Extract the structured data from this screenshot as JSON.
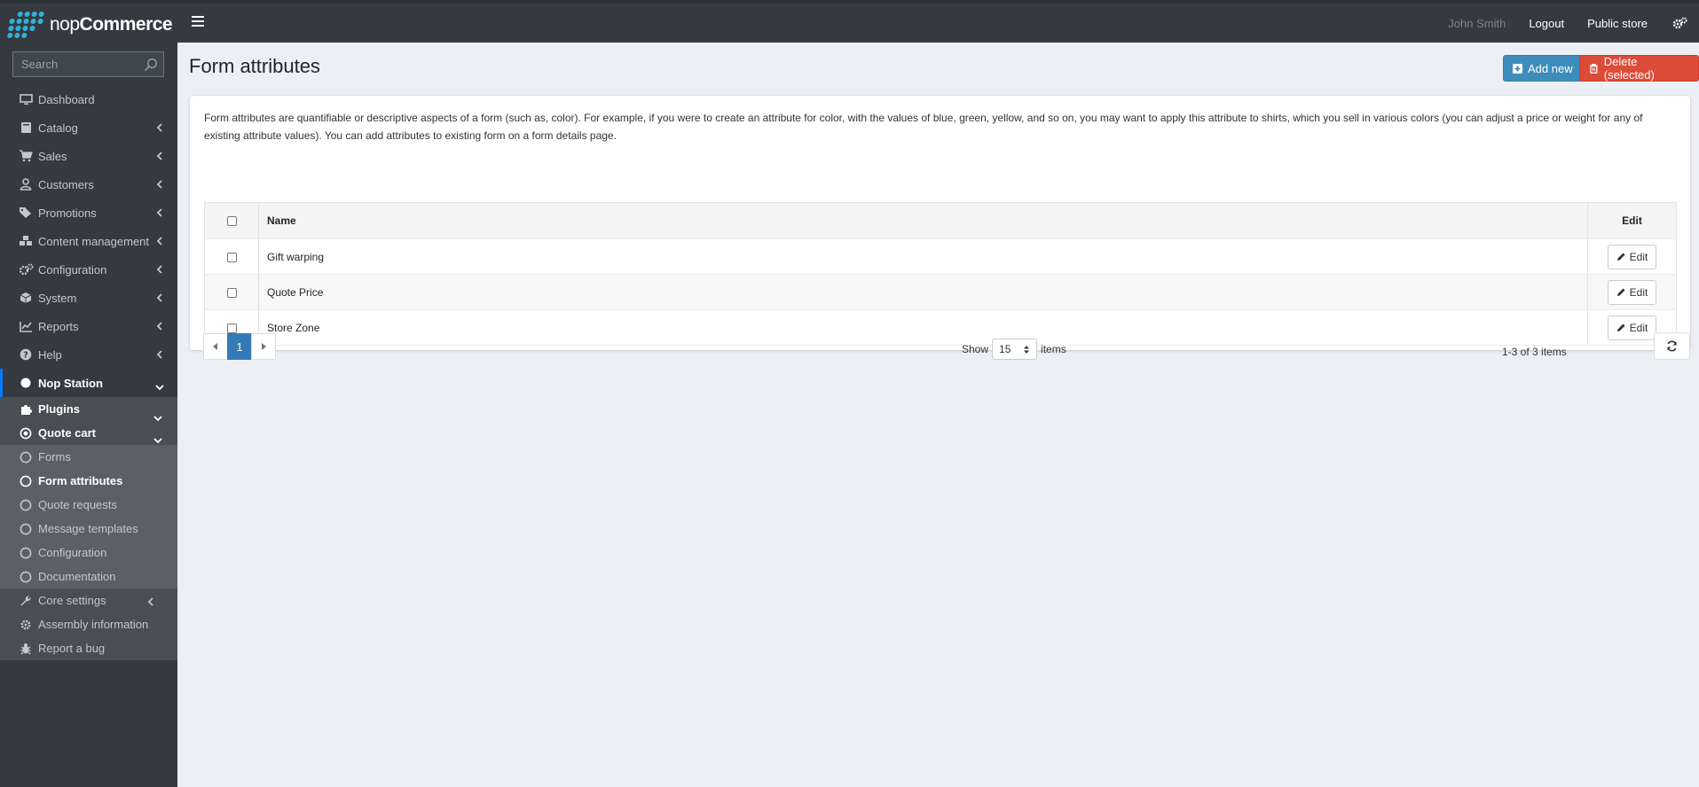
{
  "header": {
    "logo_text": "nop",
    "logo_bold": "Commerce",
    "user_name": "John Smith",
    "logout": "Logout",
    "public_store": "Public store"
  },
  "sidebar": {
    "search_placeholder": "Search",
    "items": [
      {
        "label": "Dashboard",
        "icon": "monitor-icon"
      },
      {
        "label": "Catalog",
        "icon": "book-icon"
      },
      {
        "label": "Sales",
        "icon": "cart-icon"
      },
      {
        "label": "Customers",
        "icon": "user-icon"
      },
      {
        "label": "Promotions",
        "icon": "tags-icon"
      },
      {
        "label": "Content management",
        "icon": "cubes-icon"
      },
      {
        "label": "Configuration",
        "icon": "gears-icon"
      },
      {
        "label": "System",
        "icon": "cube-icon"
      },
      {
        "label": "Reports",
        "icon": "line-chart-icon"
      },
      {
        "label": "Help",
        "icon": "question-icon"
      },
      {
        "label": "Nop Station",
        "icon": "circle-icon"
      }
    ],
    "plugins": "Plugins",
    "quote_cart": "Quote cart",
    "sub_items": [
      "Forms",
      "Form attributes",
      "Quote requests",
      "Message templates",
      "Configuration",
      "Documentation"
    ],
    "tail_items": [
      "Core settings",
      "Assembly information",
      "Report a bug"
    ]
  },
  "page": {
    "title": "Form attributes",
    "add_new": "Add new",
    "delete_selected": "Delete (selected)",
    "description_line1": "Form attributes are quantifiable or descriptive aspects of a form (such as, color). For example, if you were to create an attribute for color, with the values of blue, green, yellow, and so on, you may want to apply this attribute to shirts, which you sell in various colors (you can adjust a price or weight for any of",
    "description_line2": "existing attribute values). You can add attributes to existing form on a form details page."
  },
  "table": {
    "col_name": "Name",
    "col_edit": "Edit",
    "edit_label": "Edit",
    "rows": [
      "Gift warping",
      "Quote Price",
      "Store Zone"
    ]
  },
  "pager": {
    "current_page": "1",
    "show": "Show",
    "page_size": "15",
    "items": "items",
    "info": "1-3 of 3 items"
  }
}
